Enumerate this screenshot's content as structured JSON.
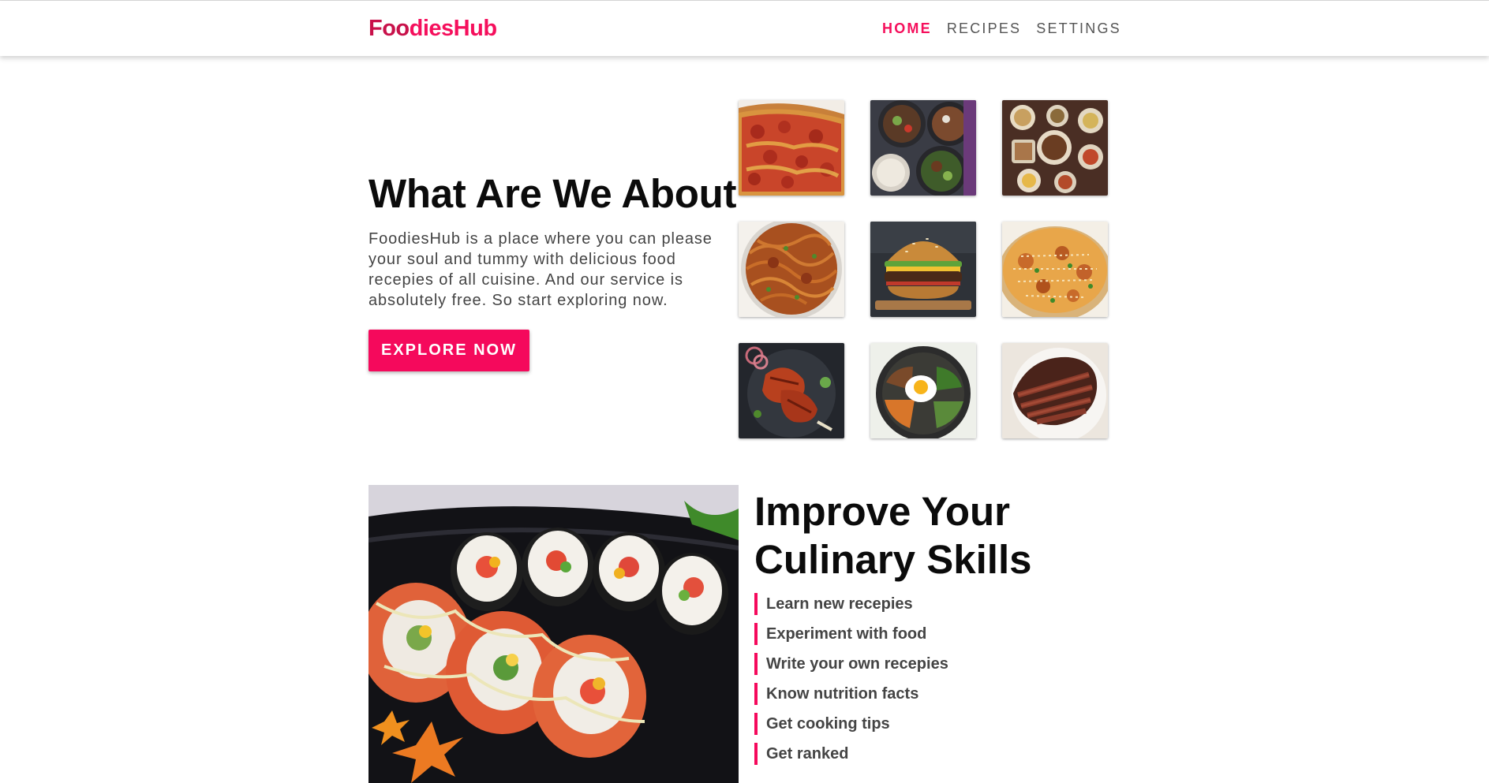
{
  "navbar": {
    "logo_part1": "Foo",
    "logo_part2": "diesHub",
    "links": [
      {
        "label": "HOME",
        "active": true
      },
      {
        "label": "RECIPES",
        "active": false
      },
      {
        "label": "SETTINGS",
        "active": false
      }
    ]
  },
  "about": {
    "title": "What Are We About",
    "text": "FoodiesHub is a place where you can please your soul and tummy with delicious food recepies of all cuisine. And our service is absolutely free. So start exploring now.",
    "button_label": "EXPLORE NOW"
  },
  "gallery": [
    {
      "name": "pizza"
    },
    {
      "name": "bowls"
    },
    {
      "name": "table-spread"
    },
    {
      "name": "noodles"
    },
    {
      "name": "burger"
    },
    {
      "name": "biryani"
    },
    {
      "name": "tandoori-chicken"
    },
    {
      "name": "bibimbap"
    },
    {
      "name": "steak"
    }
  ],
  "skills": {
    "title_line1": "Improve Your",
    "title_line2": "Culinary Skills",
    "items": [
      "Learn new recepies",
      "Experiment with food",
      "Write your own recepies",
      "Know nutrition facts",
      "Get cooking tips",
      "Get ranked"
    ]
  },
  "colors": {
    "accent": "#f5095c",
    "text_dark": "#0b0b0b",
    "text_muted": "#444444"
  }
}
